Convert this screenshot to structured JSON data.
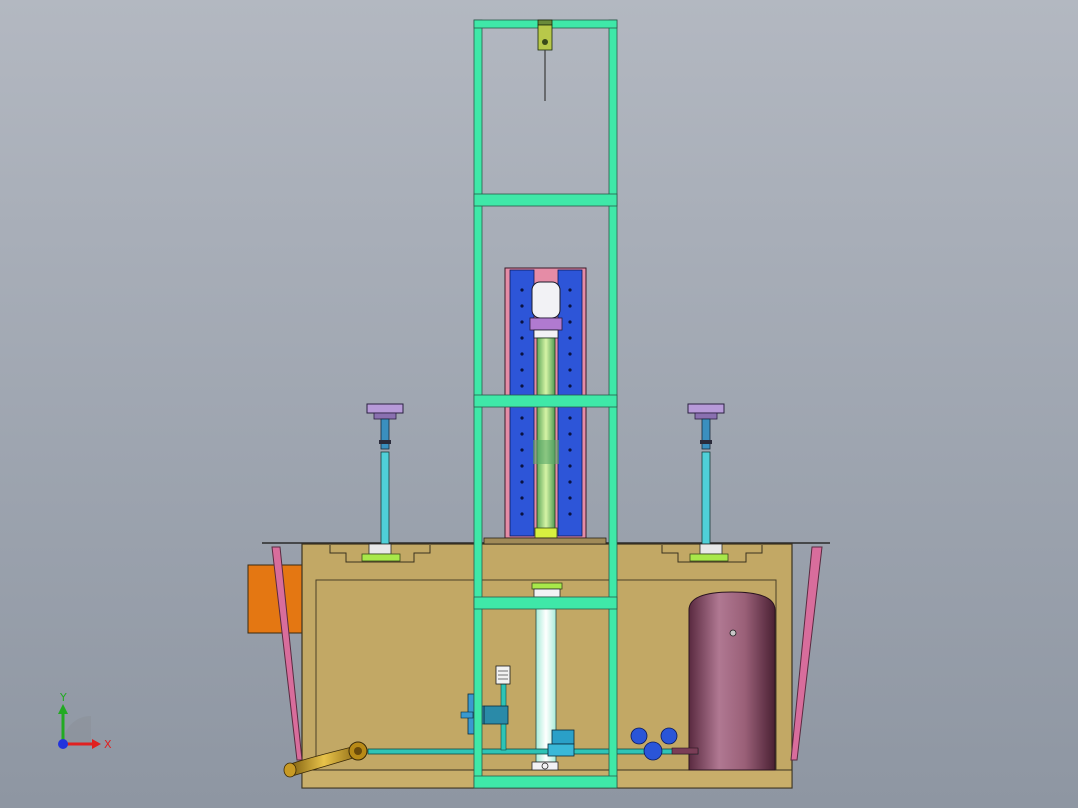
{
  "view": {
    "background_top": "#b3b8c1",
    "background_bottom": "#8e96a2"
  },
  "triad": {
    "x_label": "X",
    "y_label": "Y",
    "x_color": "#e02020",
    "y_color": "#22aa22",
    "z_color": "#2233dd"
  },
  "colors": {
    "frame": "#3fe8a8",
    "tank": "#c2a865",
    "column_plate": "#2d55d8",
    "column_edge": "#e58ca6",
    "cylinder_rod": "#8ed47a",
    "vessel": "#7a3e57",
    "pipe": "#2ec4b6",
    "handle": "#b88a16",
    "motor": "#e47712"
  }
}
